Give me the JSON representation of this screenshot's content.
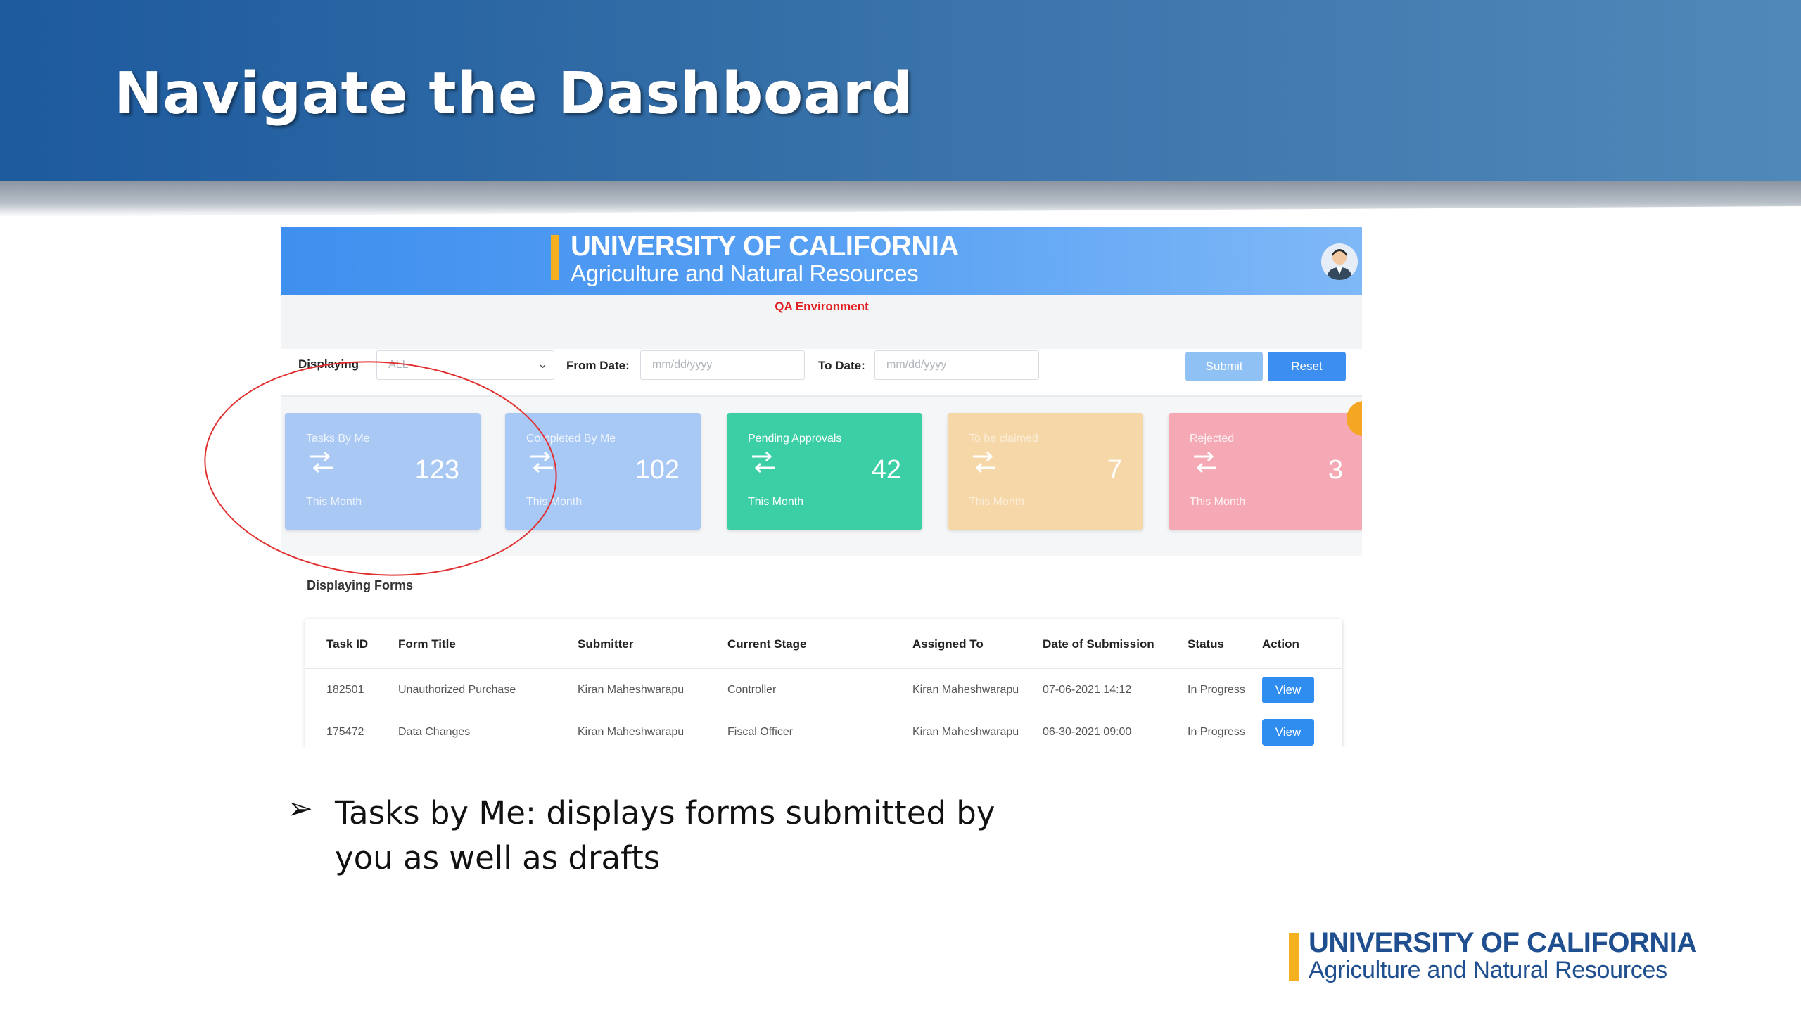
{
  "slide": {
    "title": "Navigate the Dashboard",
    "bullet_symbol": "➢",
    "bullet_text": "Tasks by Me: displays forms submitted by you as well as drafts",
    "footer_logo": {
      "line1": "UNIVERSITY OF CALIFORNIA",
      "line2": "Agriculture and Natural Resources"
    },
    "highlight_color": "#e03030"
  },
  "app": {
    "header": {
      "line1": "UNIVERSITY OF CALIFORNIA",
      "line2": "Agriculture and Natural Resources",
      "icon": "user-avatar-icon"
    },
    "environment": "QA Environment",
    "filters": {
      "displaying_label": "Displaying",
      "displaying_value": "ALL",
      "from_label": "From Date:",
      "from_placeholder": "mm/dd/yyyy",
      "to_label": "To Date:",
      "to_placeholder": "mm/dd/yyyy",
      "submit": "Submit",
      "reset": "Reset"
    },
    "cards": [
      {
        "title": "Tasks By Me",
        "value": "123",
        "sub": "This Month",
        "color": "#a9c8f3",
        "icon": "swap-arrows-icon"
      },
      {
        "title": "Completed By Me",
        "value": "102",
        "sub": "This Month",
        "color": "#a8c8f5",
        "icon": "swap-arrows-icon"
      },
      {
        "title": "Pending Approvals",
        "value": "42",
        "sub": "This Month",
        "color": "#3ccfa5",
        "icon": "swap-arrows-icon"
      },
      {
        "title": "To be claimed",
        "value": "7",
        "sub": "This Month",
        "color": "#f6d7a8",
        "icon": "swap-arrows-icon"
      },
      {
        "title": "Rejected",
        "value": "3",
        "sub": "This Month",
        "color": "#f5a9b5",
        "icon": "swap-arrows-icon"
      }
    ],
    "section_label": "Displaying Forms",
    "table": {
      "headers": [
        "Task ID",
        "Form Title",
        "Submitter",
        "Current Stage",
        "Assigned To",
        "Date of Submission",
        "Status",
        "Action"
      ],
      "rows": [
        [
          "182501",
          "Unauthorized Purchase",
          "Kiran Maheshwarapu",
          "Controller",
          "Kiran Maheshwarapu",
          "07-06-2021 14:12",
          "In Progress",
          "View"
        ],
        [
          "175472",
          "Data Changes",
          "Kiran Maheshwarapu",
          "Fiscal Officer",
          "Kiran Maheshwarapu",
          "06-30-2021 09:00",
          "In Progress",
          "View"
        ]
      ]
    }
  }
}
